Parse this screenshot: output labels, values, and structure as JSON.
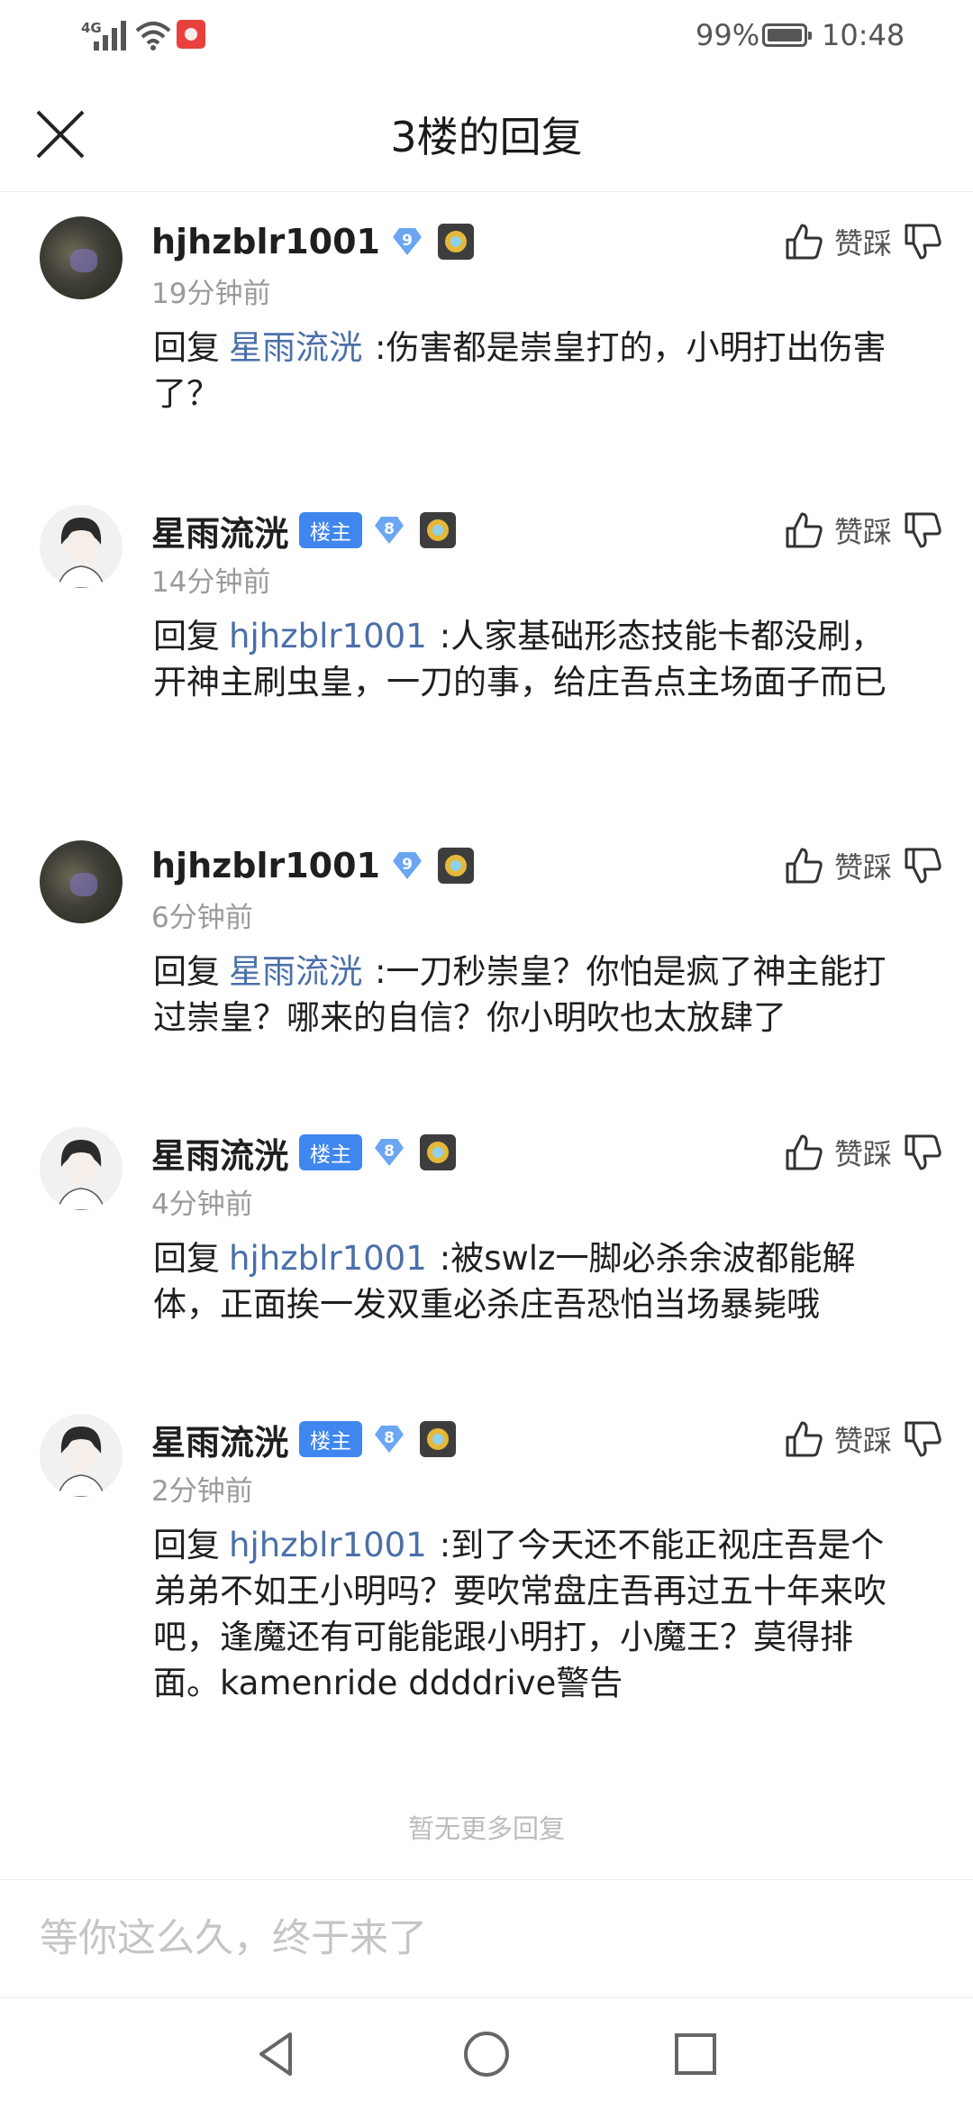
{
  "status_bar": {
    "network": "4G",
    "battery_percent": "99%",
    "battery_level": 0.99,
    "time": "10:48",
    "icons": [
      "signal-icon",
      "wifi-icon",
      "app-notification-icon",
      "battery-icon"
    ]
  },
  "header": {
    "title": "3楼的回复",
    "close_icon": "close-icon"
  },
  "labels": {
    "owner_tag": "楼主",
    "vote": "赞踩",
    "reply_prefix": "回复"
  },
  "replies": [
    {
      "username": "hjhzblr1001",
      "is_owner": false,
      "level": "9",
      "time": "19分钟前",
      "reply_to": "星雨流洸",
      "text": ":伤害都是崇皇打的，小明打出伤害了？"
    },
    {
      "username": "星雨流洸",
      "is_owner": true,
      "level": "8",
      "time": "14分钟前",
      "reply_to": "hjhzblr1001",
      "text": ":人家基础形态技能卡都没刷，开神主刷虫皇，一刀的事，给庄吾点主场面子而已"
    },
    {
      "username": "hjhzblr1001",
      "is_owner": false,
      "level": "9",
      "time": "6分钟前",
      "reply_to": "星雨流洸",
      "text": ":一刀秒崇皇？你怕是疯了神主能打过崇皇？哪来的自信？你小明吹也太放肆了"
    },
    {
      "username": "星雨流洸",
      "is_owner": true,
      "level": "8",
      "time": "4分钟前",
      "reply_to": "hjhzblr1001",
      "text": ":被swlz一脚必杀余波都能解体，正面挨一发双重必杀庄吾恐怕当场暴毙哦"
    },
    {
      "username": "星雨流洸",
      "is_owner": true,
      "level": "8",
      "time": "2分钟前",
      "reply_to": "hjhzblr1001",
      "text": ":到了今天还不能正视庄吾是个弟弟不如王小明吗？要吹常盘庄吾再过五十年来吹吧，逢魔还有可能能跟小明打，小魔王？莫得排面。kamenride ddddrive警告"
    }
  ],
  "footer": {
    "no_more": "暂无更多回复",
    "input_placeholder": "等你这么久，终于来了"
  },
  "colors": {
    "mention": "#4a6fa9",
    "owner_tag_bg": "#3f86ee",
    "level_badge": "#6aa6f2",
    "secondary_text": "#9a9a9a"
  }
}
